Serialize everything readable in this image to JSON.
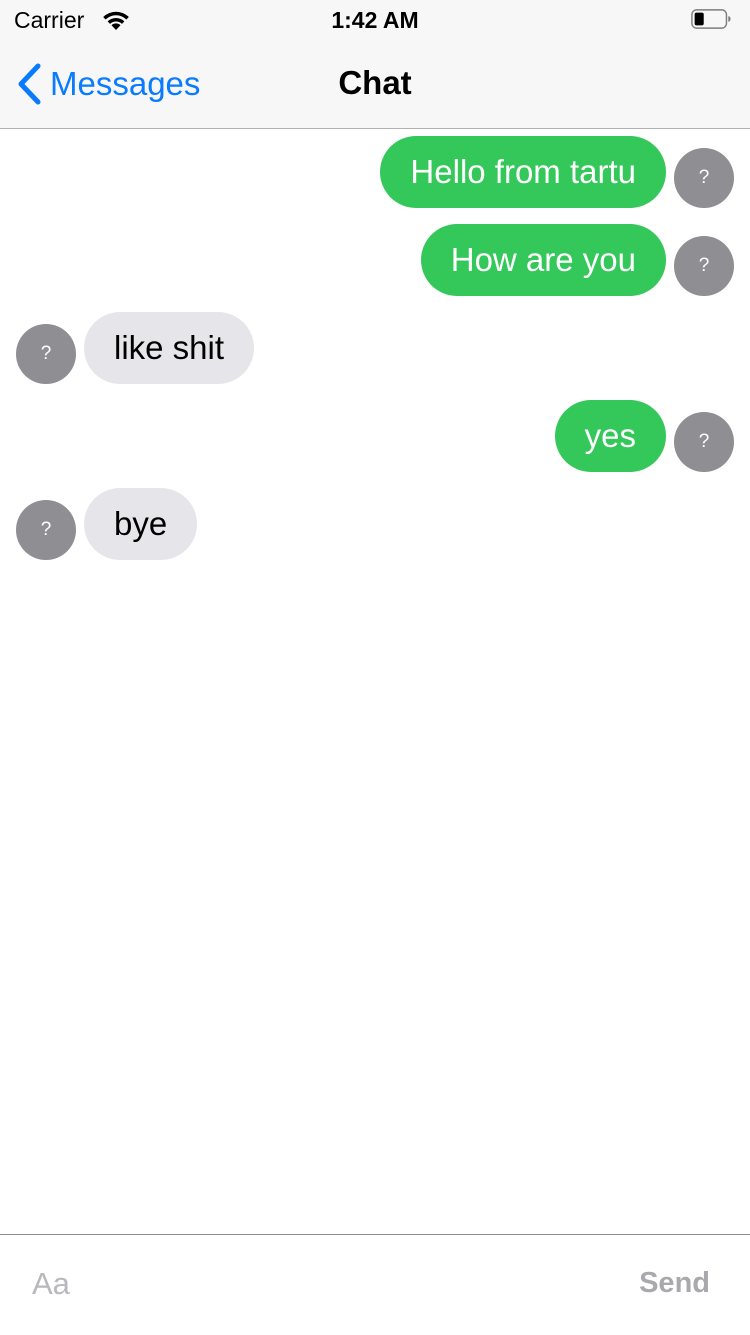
{
  "status_bar": {
    "carrier": "Carrier",
    "time": "1:42 AM",
    "wifi_icon": "wifi-icon",
    "battery_icon": "battery-icon"
  },
  "nav": {
    "back_label": "Messages",
    "title": "Chat",
    "back_icon": "chevron-left-icon"
  },
  "messages": [
    {
      "direction": "outgoing",
      "text": "Hello from tartu",
      "avatar": "?"
    },
    {
      "direction": "outgoing",
      "text": "How are you",
      "avatar": "?"
    },
    {
      "direction": "incoming",
      "text": "like shit",
      "avatar": "?"
    },
    {
      "direction": "outgoing",
      "text": "yes",
      "avatar": "?"
    },
    {
      "direction": "incoming",
      "text": "bye",
      "avatar": "?"
    }
  ],
  "input": {
    "placeholder": "Aa",
    "value": "",
    "send_label": "Send"
  },
  "colors": {
    "outgoing_bubble": "#34c759",
    "incoming_bubble": "#e5e5ea",
    "avatar": "#8e8e93",
    "accent": "#0a7aff"
  }
}
